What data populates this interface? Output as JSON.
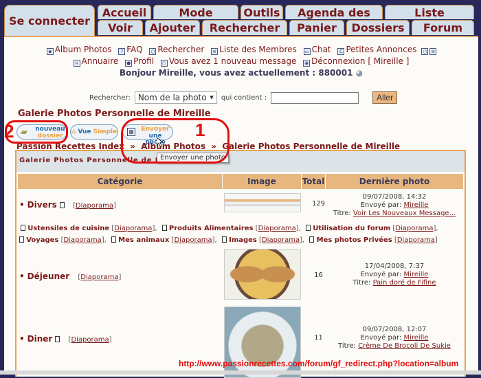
{
  "tabs": {
    "login": "Se connecter",
    "row1": [
      "Accueil",
      "Mode d'emploi",
      "Outils",
      "Agenda des repas",
      "Liste d'épicerie"
    ],
    "row2": [
      "Voir",
      "Ajouter",
      "Rechercher",
      "Panier",
      "Dossiers",
      "Forum"
    ]
  },
  "nav": {
    "line1": [
      {
        "icon": "album-icon",
        "label": "Album Photos"
      },
      {
        "icon": "faq-icon",
        "label": "FAQ"
      },
      {
        "icon": "search-icon",
        "label": "Rechercher"
      },
      {
        "icon": "list-icon",
        "label": "Liste des Membres"
      },
      {
        "icon": "chat-icon",
        "label": "Chat"
      },
      {
        "icon": "ads-icon",
        "label": "Petites Annonces"
      }
    ],
    "line2": [
      {
        "icon": "directory-icon",
        "label": "Annuaire"
      },
      {
        "icon": "profile-icon",
        "label": "Profil"
      },
      {
        "icon": "message-icon",
        "label": "Vous avez 1 nouveau message"
      },
      {
        "icon": "logout-icon",
        "label": "Déconnexion [ Mireille ]"
      }
    ],
    "greeting": "Bonjour Mireille, vous avez actuellement : 880001"
  },
  "search": {
    "label": "Rechercher:",
    "select_value": "Nom de la photo",
    "contains_label": "qui contient :",
    "input_value": "",
    "button": "Aller"
  },
  "page_title": "Galerie Photos Personnelle de Mireille",
  "buttons": {
    "new_folder_line1": "nouveau",
    "new_folder_line2": "dossier",
    "simple_view_a": "Vue",
    "simple_view_b": "Simple",
    "upload_line1": "Envoyer",
    "upload_line2": "une photo"
  },
  "tooltip": "Envoyer une photo",
  "breadcrumb": [
    "Passion Recettes Index",
    "Album Photos",
    "Galerie Photos Personnelle de Mireille"
  ],
  "breadcrumb_sep": "»",
  "panel_title": "Galerie Photos Personnelle de Mireille",
  "table": {
    "headers": [
      "Catégorie",
      "Image",
      "Total",
      "Dernière photo"
    ],
    "diaporama": "Diaporama",
    "rows": [
      {
        "name": "Divers",
        "total": "129",
        "date": "09/07/2008, 14:32",
        "sent_by_label": "Envoyé par:",
        "sent_by": "Mireille",
        "title_label": "Titre:",
        "title": "Voir Les Nouveaux Message..."
      },
      {
        "name": "Déjeuner",
        "total": "16",
        "date": "17/04/2008, 7:37",
        "sent_by_label": "Envoyé par:",
        "sent_by": "Mireille",
        "title_label": "Titre:",
        "title": "Pain doré de Fifine"
      },
      {
        "name": "Diner",
        "total": "11",
        "date": "09/07/2008, 12:07",
        "sent_by_label": "Envoyé par:",
        "sent_by": "Mireille",
        "title_label": "Titre:",
        "title": "Crème De Brocoli De Sukie"
      }
    ],
    "subcategories": [
      "Ustensiles de cuisine",
      "Produits Alimentaires",
      "Utilisation du forum",
      "Voyages",
      "Mes animaux",
      "Images",
      "Mes photos Privées"
    ]
  },
  "annotations": {
    "one": "1",
    "two": "2"
  },
  "url_caption": "http://www.passionrecettes.com/forum/gf_redirect.php?location=album"
}
